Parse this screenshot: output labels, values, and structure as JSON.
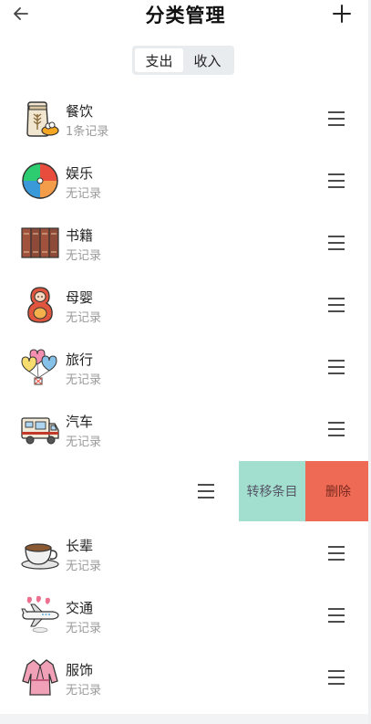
{
  "header": {
    "title": "分类管理",
    "back_icon": "arrow-left-icon",
    "add_icon": "plus-icon"
  },
  "tabs": [
    {
      "label": "支出",
      "active": true
    },
    {
      "label": "收入",
      "active": false
    }
  ],
  "categories": [
    {
      "name": "餐饮",
      "sub": "1条记录",
      "icon": "rice-sack-icon"
    },
    {
      "name": "娱乐",
      "sub": "无记录",
      "icon": "beach-ball-icon"
    },
    {
      "name": "书籍",
      "sub": "无记录",
      "icon": "books-icon"
    },
    {
      "name": "母婴",
      "sub": "无记录",
      "icon": "matryoshka-doll-icon"
    },
    {
      "name": "旅行",
      "sub": "无记录",
      "icon": "heart-balloons-icon"
    },
    {
      "name": "汽车",
      "sub": "无记录",
      "icon": "camper-truck-icon"
    },
    {
      "name": "",
      "sub": "",
      "icon": ""
    },
    {
      "name": "长辈",
      "sub": "无记录",
      "icon": "coffee-cup-icon"
    },
    {
      "name": "交通",
      "sub": "无记录",
      "icon": "airplane-icon"
    },
    {
      "name": "服饰",
      "sub": "无记录",
      "icon": "robe-icon"
    }
  ],
  "swipe_actions": {
    "transfer_label": "转移条目",
    "delete_label": "删除",
    "transfer_color": "#a3dfcf",
    "delete_color": "#ee6a55"
  }
}
